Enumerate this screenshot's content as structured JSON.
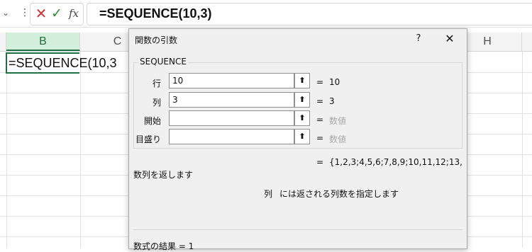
{
  "formula_bar": {
    "formula": "=SEQUENCE(10,3)",
    "cancel_icon": "x-icon",
    "enter_icon": "check-icon",
    "function_icon": "fx-icon",
    "fx_label": "fx",
    "more_glyph": "⋮"
  },
  "columns": {
    "B": "B",
    "C": "C",
    "H": "H"
  },
  "active_cell": {
    "text": "=SEQUENCE(10,3"
  },
  "dialog": {
    "title": "関数の引数",
    "help_label": "?",
    "close_label": "✕",
    "function_name": "SEQUENCE",
    "args": [
      {
        "label": "行",
        "value": "10",
        "result": "10"
      },
      {
        "label": "列",
        "value": "3",
        "result": "3"
      },
      {
        "label": "開始",
        "value": "",
        "result": "数値"
      },
      {
        "label": "目盛り",
        "value": "",
        "result": "数値"
      }
    ],
    "ref_button": "⬆",
    "equals": "=",
    "overall_result": "{1,2,3;4,5,6;7,8,9;10,11,12;13,",
    "description": "数列を返します",
    "arg_desc_name": "列",
    "arg_desc_text": "には返される列数を指定します",
    "formula_result": "数式の結果 =   1"
  },
  "colors": {
    "accent_green": "#1e7145",
    "cancel_red": "#d13438",
    "enter_green": "#2e8b3a"
  }
}
